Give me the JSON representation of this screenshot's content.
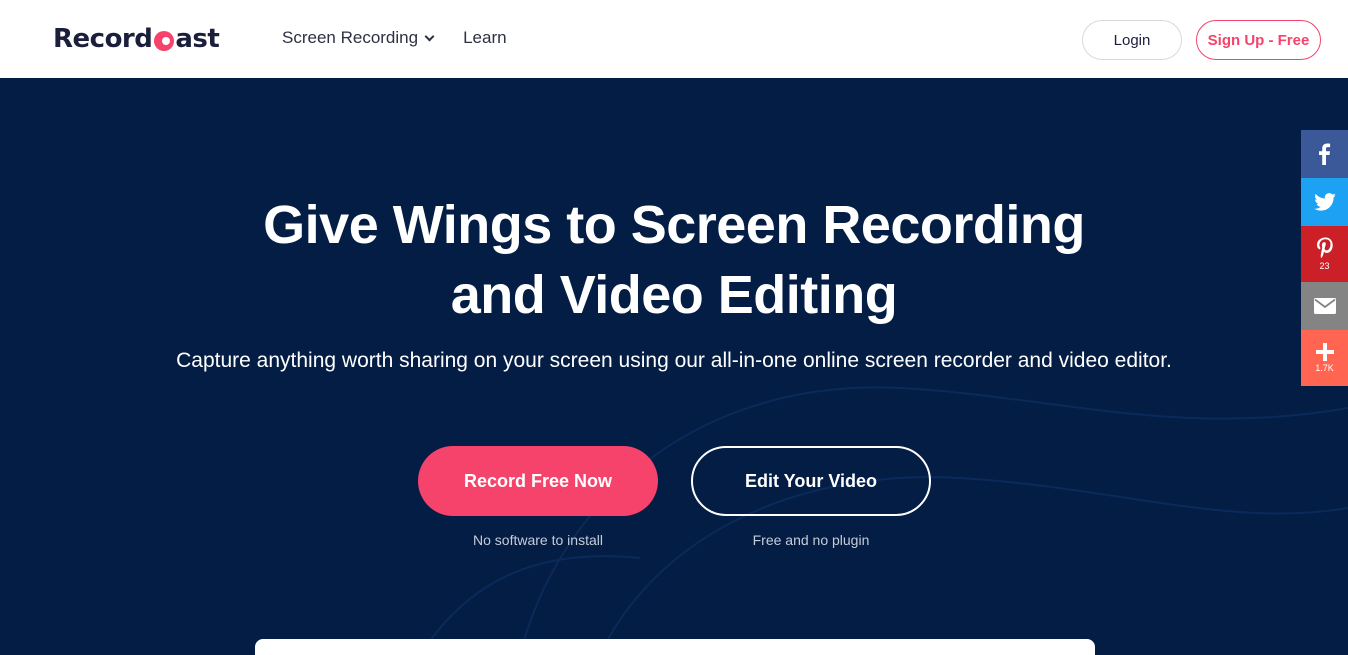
{
  "header": {
    "logo": {
      "before": "Record",
      "after": "ast"
    },
    "nav": [
      {
        "label": "Screen Recording",
        "has_dropdown": true
      },
      {
        "label": "Learn",
        "has_dropdown": false
      }
    ],
    "login_label": "Login",
    "signup_label": "Sign Up - Free"
  },
  "hero": {
    "headline_line1": "Give Wings to Screen Recording",
    "headline_line2": "and Video Editing",
    "subtitle": "Capture anything worth sharing on your screen using our all-in-one online screen recorder and video editor.",
    "primary_cta": "Record Free Now",
    "primary_note": "No software to install",
    "secondary_cta": "Edit Your Video",
    "secondary_note": "Free and no plugin"
  },
  "share_bar": {
    "items": [
      {
        "network": "facebook",
        "icon": "facebook-icon",
        "count": ""
      },
      {
        "network": "twitter",
        "icon": "twitter-icon",
        "count": ""
      },
      {
        "network": "pinterest",
        "icon": "pinterest-icon",
        "count": "23"
      },
      {
        "network": "email",
        "icon": "email-icon",
        "count": ""
      },
      {
        "network": "more",
        "icon": "plus-icon",
        "count": "1.7K"
      }
    ]
  },
  "colors": {
    "brand_accent": "#f5436b",
    "hero_background": "#031d44",
    "facebook": "#3b5998",
    "twitter": "#1da1f2",
    "pinterest": "#cb2027",
    "email": "#848484",
    "more": "#ff6550"
  }
}
